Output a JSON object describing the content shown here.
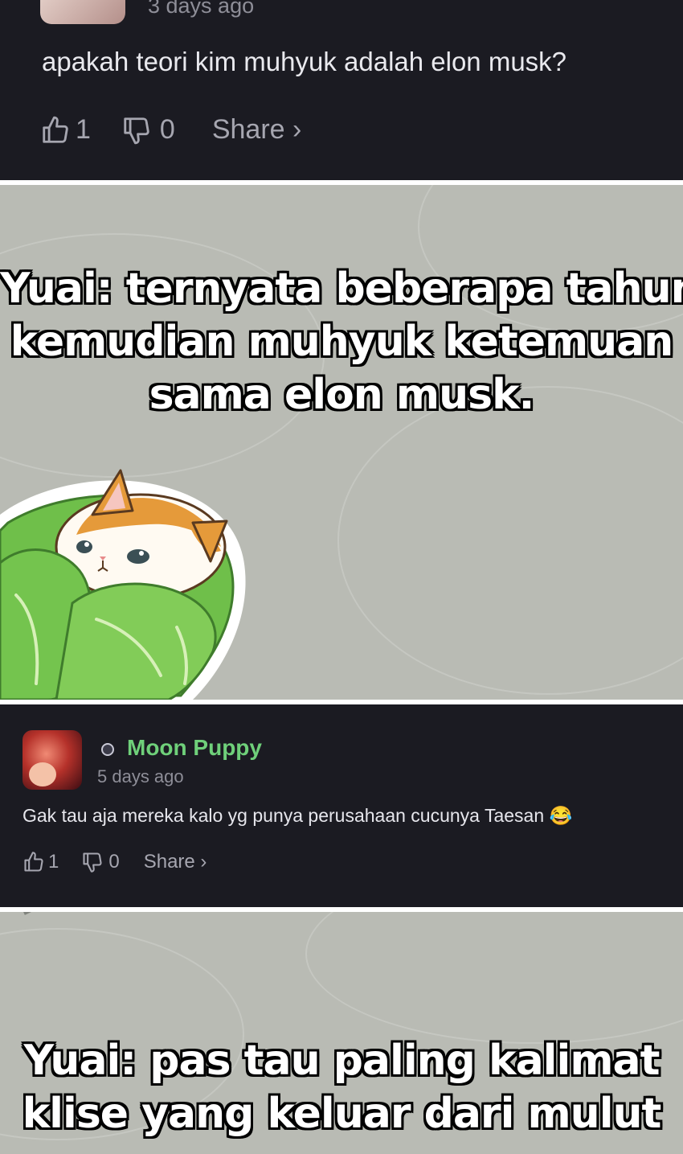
{
  "top_comment": {
    "time": "3 days ago",
    "text": "apakah teori kim muhyuk adalah elon musk?",
    "likes": "1",
    "dislikes": "0",
    "share_label": "Share ›"
  },
  "caption_1": {
    "lines": [
      "Yuai: ternyata beberapa tahun",
      "kemudian muhyuk ketemuan",
      "sama elon musk."
    ]
  },
  "comment_2": {
    "username": "Moon Puppy",
    "time": "5 days ago",
    "text": "Gak tau aja mereka kalo yg punya perusahaan cucunya Taesan 😂",
    "likes": "1",
    "dislikes": "0",
    "share_label": "Share ›"
  },
  "caption_2": {
    "lines": [
      "Yuai: pas tau paling kalimat",
      "klise yang keluar dari mulut"
    ]
  },
  "colors": {
    "panel_bg": "#1b1b22",
    "meme_bg": "#b9bbb4",
    "username": "#6fd07a",
    "cabbage": "#6fbf4a",
    "cat_orange": "#e59a3a"
  },
  "icons": [
    "thumbs-up-icon",
    "thumbs-down-icon",
    "chevron-right-icon",
    "badge-icon",
    "cat-cabbage-sticker"
  ]
}
